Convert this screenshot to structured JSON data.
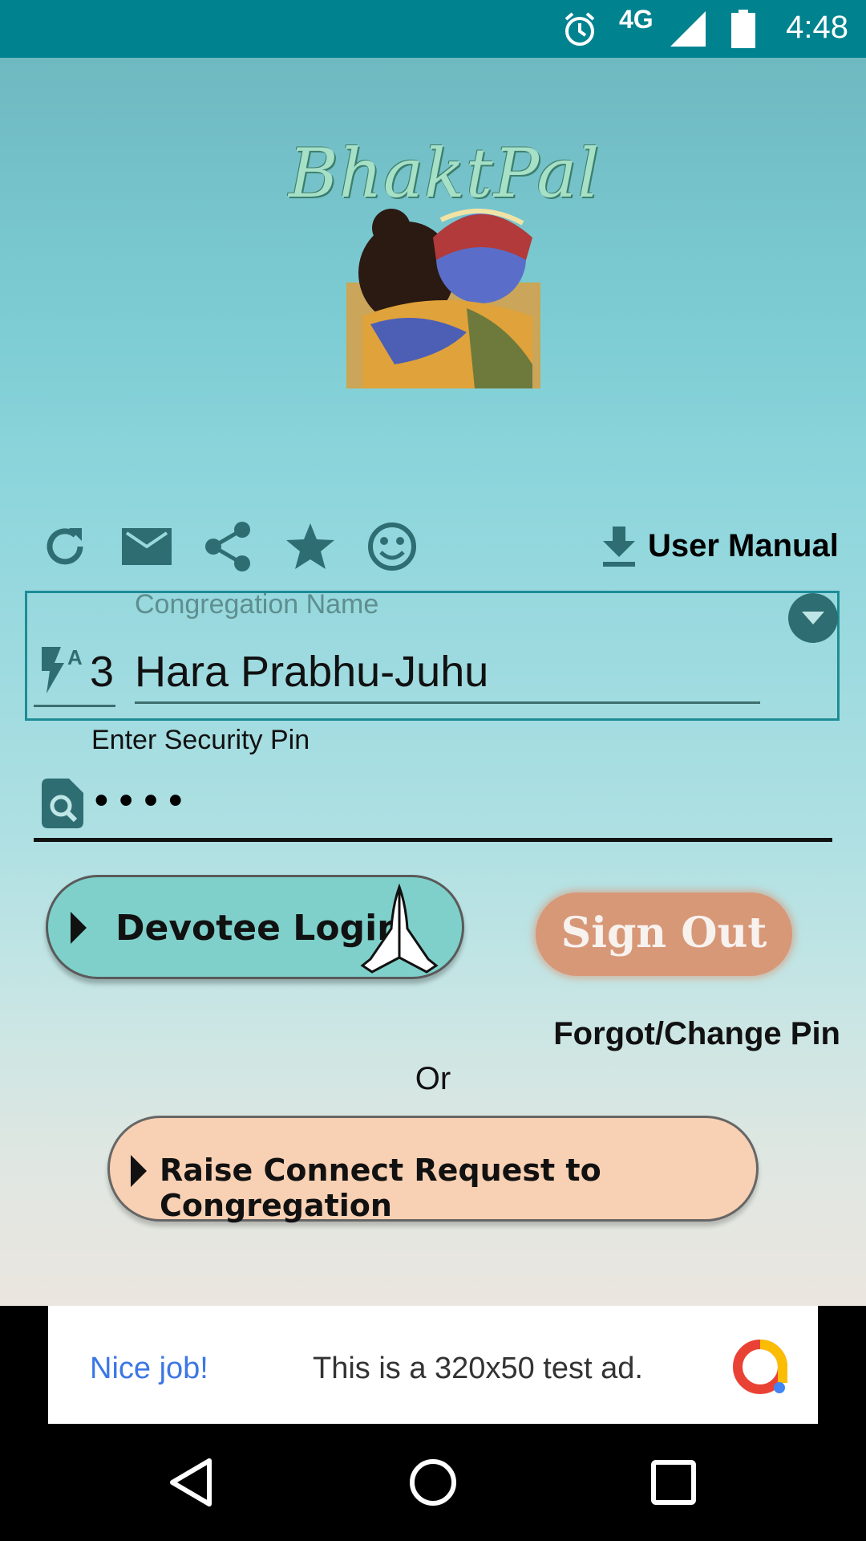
{
  "status_bar": {
    "time": "4:48",
    "network": "4G"
  },
  "app": {
    "logo_text": "BhaktPal"
  },
  "toolbar": {
    "icons": [
      "refresh-icon",
      "mail-icon",
      "share-icon",
      "star-icon",
      "smiley-icon"
    ],
    "user_manual_label": "User Manual"
  },
  "congregation": {
    "label": "Congregation Name",
    "prefix_number": "3",
    "value": "Hara Prabhu-Juhu"
  },
  "security_pin": {
    "label": "Enter Security Pin",
    "value": "••••"
  },
  "buttons": {
    "devotee_login": "Devotee Login",
    "sign_out": "Sign Out",
    "forgot_pin": "Forgot/Change Pin",
    "or": "Or",
    "raise_connect": "Raise Connect Request to Congregation"
  },
  "ad": {
    "headline": "Nice job!",
    "message": "This is a 320x50 test ad."
  },
  "colors": {
    "status_bar": "#00838f",
    "accent": "#2e6e72",
    "login_button": "#7fd0ca",
    "sign_out_button": "#d79878",
    "connect_button": "#f8d0b3"
  }
}
